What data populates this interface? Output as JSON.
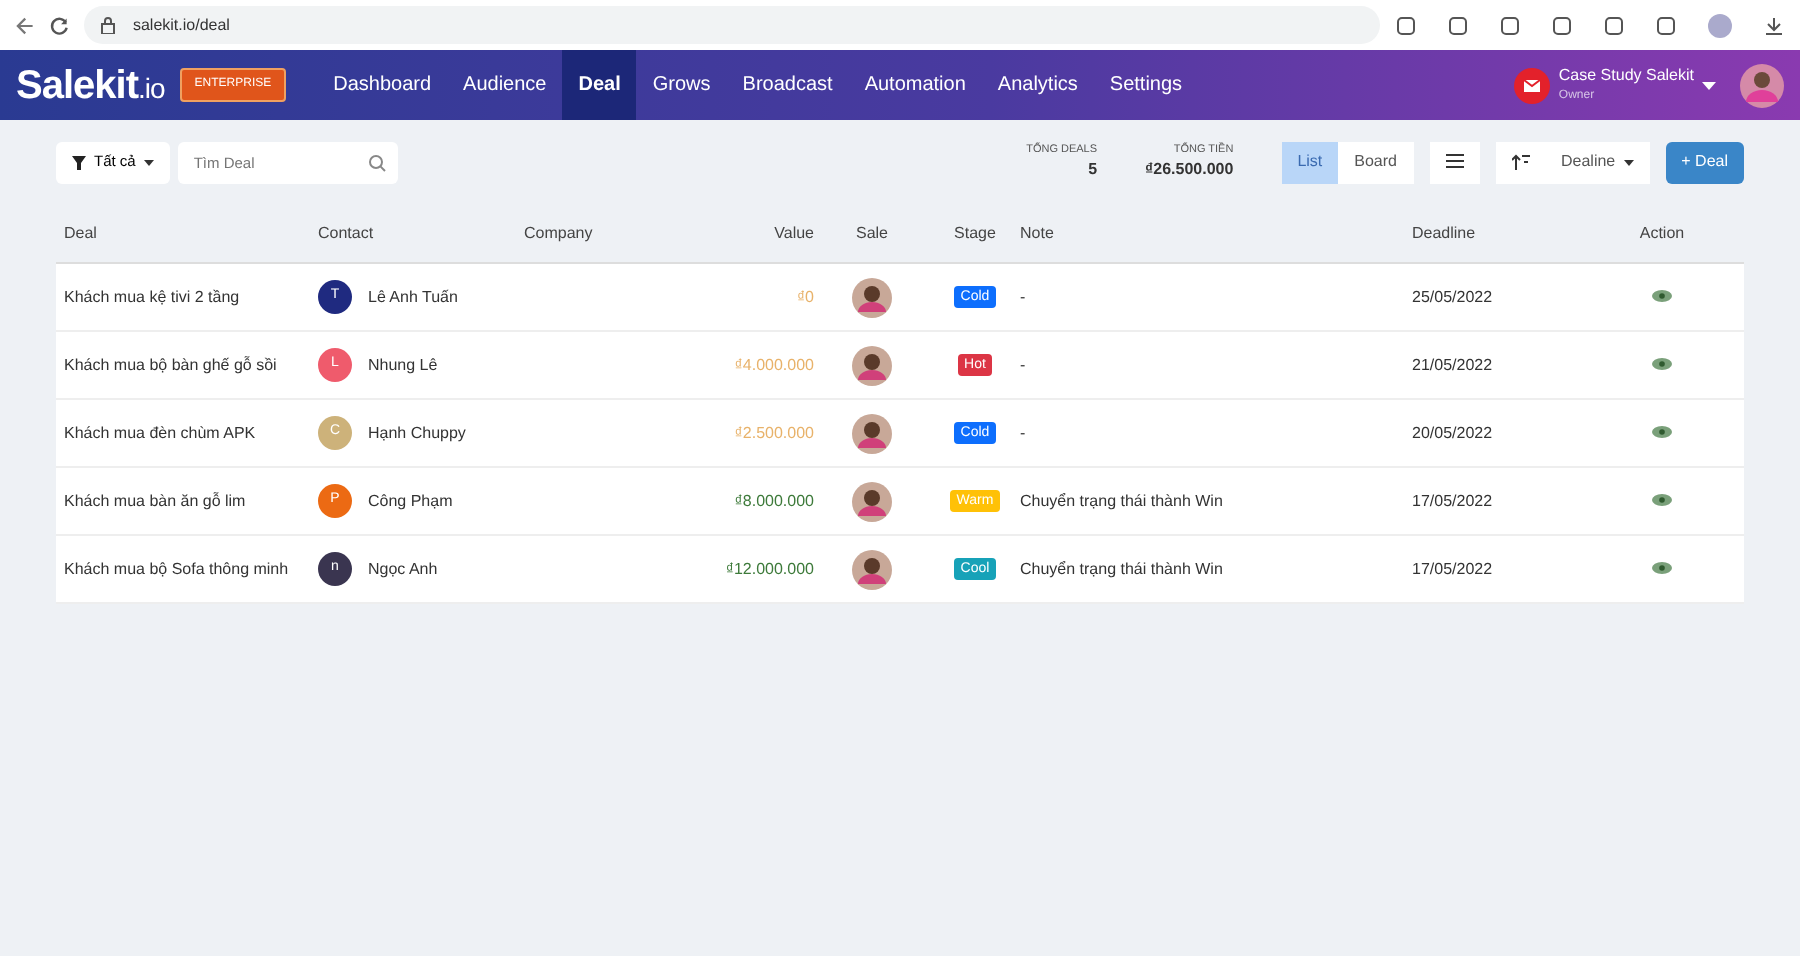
{
  "browser": {
    "url": "salekit.io/deal"
  },
  "brand": {
    "name": "Salekit",
    "suffix": ".io",
    "badge": "ENTERPRISE"
  },
  "nav": [
    {
      "label": "Dashboard",
      "selected": false
    },
    {
      "label": "Audience",
      "selected": false
    },
    {
      "label": "Deal",
      "selected": true
    },
    {
      "label": "Grows",
      "selected": false
    },
    {
      "label": "Broadcast",
      "selected": false
    },
    {
      "label": "Automation",
      "selected": false
    },
    {
      "label": "Analytics",
      "selected": false
    },
    {
      "label": "Settings",
      "selected": false
    }
  ],
  "account": {
    "name": "Case Study Salekit",
    "role": "Owner"
  },
  "toolbar": {
    "filter": "Tất cả",
    "search_placeholder": "Tìm Deal",
    "total_deals_label": "TỔNG DEALS",
    "total_deals": "5",
    "total_money_label": "TỔNG TIỀN",
    "total_money": "₫26.500.000",
    "views": [
      {
        "label": "List",
        "selected": true
      },
      {
        "label": "Board",
        "selected": false
      }
    ],
    "sort": "Dealine",
    "add": "+ Deal"
  },
  "table": {
    "columns": [
      "Deal",
      "Contact",
      "Company",
      "Value",
      "Sale",
      "Stage",
      "Note",
      "Deadline",
      "Action"
    ],
    "rows": [
      {
        "deal": "Khách mua kệ tivi 2 tầng",
        "contact": {
          "initial": "T",
          "name": "Lê Anh Tuấn",
          "color": "#1f2a80"
        },
        "value": {
          "text": "₫0",
          "color": "#e8b26a"
        },
        "stage": {
          "label": "Cold",
          "color": "#0d6efd"
        },
        "note": "-",
        "deadline": "25/05/2022"
      },
      {
        "deal": "Khách mua bộ bàn ghế gỗ sồi",
        "contact": {
          "initial": "L",
          "name": "Nhung Lê",
          "color": "#ef5b6c"
        },
        "value": {
          "text": "₫4.000.000",
          "color": "#e8b26a"
        },
        "stage": {
          "label": "Hot",
          "color": "#dc3545"
        },
        "note": "-",
        "deadline": "21/05/2022"
      },
      {
        "deal": "Khách mua đèn chùm APK",
        "contact": {
          "initial": "C",
          "name": "Hạnh Chuppy",
          "color": "#cdb27a"
        },
        "value": {
          "text": "₫2.500.000",
          "color": "#e8b26a"
        },
        "stage": {
          "label": "Cold",
          "color": "#0d6efd"
        },
        "note": "-",
        "deadline": "20/05/2022"
      },
      {
        "deal": "Khách mua bàn ăn gỗ lim",
        "contact": {
          "initial": "P",
          "name": "Công Phạm",
          "color": "#ec6a13"
        },
        "value": {
          "text": "₫8.000.000",
          "color": "#3d7a3a"
        },
        "stage": {
          "label": "Warm",
          "color": "#ffc107"
        },
        "note": "Chuyển trạng thái thành Win",
        "deadline": "17/05/2022"
      },
      {
        "deal": "Khách mua bộ Sofa thông minh",
        "contact": {
          "initial": "n",
          "name": "Ngọc Anh",
          "color": "#3a3550"
        },
        "value": {
          "text": "₫12.000.000",
          "color": "#3d7a3a"
        },
        "stage": {
          "label": "Cool",
          "color": "#17a2b8"
        },
        "note": "Chuyển trạng thái thành Win",
        "deadline": "17/05/2022"
      }
    ]
  }
}
